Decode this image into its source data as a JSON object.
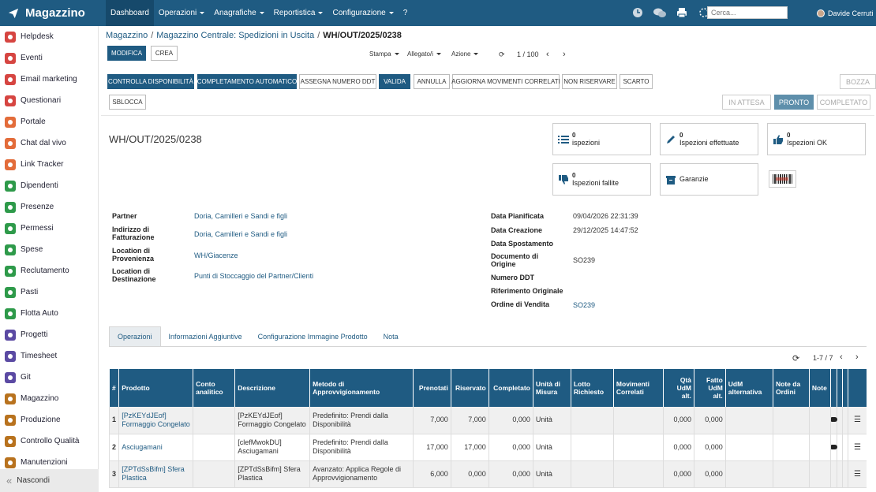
{
  "app": {
    "name": "Magazzino"
  },
  "topnav": {
    "items": [
      "Dashboard",
      "Operazioni",
      "Anagrafiche",
      "Reportistica",
      "Configurazione",
      "?"
    ],
    "search_placeholder": "Cerca...",
    "user": "Davide Cerruti"
  },
  "sidebar": {
    "items": [
      {
        "label": "Helpdesk",
        "color": "#d64541"
      },
      {
        "label": "Eventi",
        "color": "#d64541"
      },
      {
        "label": "Email marketing",
        "color": "#d64541"
      },
      {
        "label": "Questionari",
        "color": "#d64541"
      },
      {
        "label": "Portale",
        "color": "#e36c3a"
      },
      {
        "label": "Chat dal vivo",
        "color": "#e36c3a"
      },
      {
        "label": "Link Tracker",
        "color": "#e36c3a"
      },
      {
        "label": "Dipendenti",
        "color": "#2e9a4a"
      },
      {
        "label": "Presenze",
        "color": "#2e9a4a"
      },
      {
        "label": "Permessi",
        "color": "#2e9a4a"
      },
      {
        "label": "Spese",
        "color": "#2e9a4a"
      },
      {
        "label": "Reclutamento",
        "color": "#2e9a4a"
      },
      {
        "label": "Pasti",
        "color": "#2e9a4a"
      },
      {
        "label": "Flotta Auto",
        "color": "#2e9a4a"
      },
      {
        "label": "Progetti",
        "color": "#5b4aa3"
      },
      {
        "label": "Timesheet",
        "color": "#5b4aa3"
      },
      {
        "label": "Git",
        "color": "#5b4aa3"
      },
      {
        "label": "Magazzino",
        "color": "#b8721e"
      },
      {
        "label": "Produzione",
        "color": "#b8721e"
      },
      {
        "label": "Controllo Qualità",
        "color": "#b8721e"
      },
      {
        "label": "Manutenzioni",
        "color": "#b8721e"
      }
    ],
    "footer": "Nascondi"
  },
  "breadcrumb": [
    "Magazzino",
    "Magazzino Centrale: Spedizioni in Uscita",
    "WH/OUT/2025/0238"
  ],
  "controls": {
    "edit": "MODIFICA",
    "create": "CREA",
    "print": "Stampa",
    "attach": "Allegato/i",
    "action": "Azione",
    "pager": "1 / 100"
  },
  "actions": [
    "CONTROLLA DISPONIBILITÀ",
    "COMPLETAMENTO AUTOMATICO",
    "ASSEGNA NUMERO DDT",
    "VALIDA",
    "ANNULLA",
    "AGGIORNA MOVIMENTI CORRELATI",
    "NON RISERVARE",
    "SCARTO",
    "SBLOCCA"
  ],
  "stages": {
    "draft": "BOZZA",
    "waiting": "IN ATTESA",
    "ready": "PRONTO",
    "done": "COMPLETATO"
  },
  "record": {
    "name": "WH/OUT/2025/0238"
  },
  "smart": {
    "ispezioni": {
      "count": "0",
      "label": "ispezioni"
    },
    "effettuate": {
      "count": "0",
      "label": "Ispezioni effettuate"
    },
    "ok": {
      "count": "0",
      "label": "Ispezioni OK"
    },
    "fallite": {
      "count": "0",
      "label": "Ispezioni fallite"
    },
    "garanzie": {
      "label": "Garanzie"
    }
  },
  "fields_left": [
    {
      "label": "Partner",
      "value": "Doria, Camilleri e Sandi e figli"
    },
    {
      "label": "Indirizzo di Fatturazione",
      "value": "Doria, Camilleri e Sandi e figli"
    },
    {
      "label": "Location di Provenienza",
      "value": "WH/Giacenze"
    },
    {
      "label": "Location di Destinazione",
      "value": "Punti di Stoccaggio del Partner/Clienti"
    }
  ],
  "fields_right": [
    {
      "label": "Data Pianificata",
      "value": "09/04/2026 22:31:39"
    },
    {
      "label": "Data Creazione",
      "value": "29/12/2025 14:47:52"
    },
    {
      "label": "Data Spostamento",
      "value": ""
    },
    {
      "label": "Documento di Origine",
      "value": "SO239"
    },
    {
      "label": "Numero DDT",
      "value": ""
    },
    {
      "label": "Riferimento Originale",
      "value": ""
    },
    {
      "label": "Ordine di Vendita",
      "value": "SO239"
    }
  ],
  "tabs": [
    "Operazioni",
    "Informazioni Aggiuntive",
    "Configurazione Immagine Prodotto",
    "Nota"
  ],
  "table": {
    "pager": "1-7 / 7",
    "headers": [
      "#",
      "Prodotto",
      "Conto analitico",
      "Descrizione",
      "Metodo di Approvvigionamento",
      "Prenotati",
      "Riservato",
      "Completato",
      "Unità di Misura",
      "Lotto Richiesto",
      "Movimenti Correlati",
      "Qtà UdM alt.",
      "Fatto UdM alt.",
      "UdM alternativa",
      "Note da Ordini",
      "Note"
    ],
    "rows": [
      {
        "n": "1",
        "product": "[PzKEYdJEof] Formaggio Congelato",
        "account": "",
        "desc": "[PzKEYdJEof] Formaggio Congelato",
        "method": "Predefinito: Prendi dalla Disponibilità",
        "prenotati": "7,000",
        "riservato": "7,000",
        "completato": "0,000",
        "uom": "Unità",
        "qty_alt": "0,000",
        "done_alt": "0,000"
      },
      {
        "n": "2",
        "product": "Asciugamani",
        "account": "",
        "desc": "[clefMwokDU] Asciugamani",
        "method": "Predefinito: Prendi dalla Disponibilità",
        "prenotati": "17,000",
        "riservato": "17,000",
        "completato": "0,000",
        "uom": "Unità",
        "qty_alt": "0,000",
        "done_alt": "0,000"
      },
      {
        "n": "3",
        "product": "[ZPTdSsBifm] Sfera Plastica",
        "account": "",
        "desc": "[ZPTdSsBifm] Sfera Plastica",
        "method": "Avanzato: Applica Regole di Approvvigionamento",
        "prenotati": "6,000",
        "riservato": "0,000",
        "completato": "0,000",
        "uom": "Unità",
        "qty_alt": "0,000",
        "done_alt": "0,000"
      }
    ]
  }
}
